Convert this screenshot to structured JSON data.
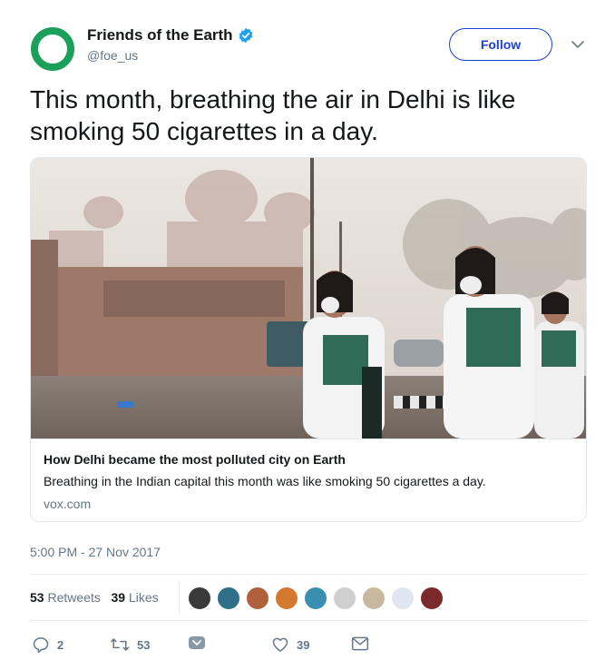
{
  "account": {
    "name": "Friends of the Earth",
    "handle": "@foe_us",
    "brand_color": "#1aa05a"
  },
  "follow_label": "Follow",
  "tweet_text": "This month, breathing the air in Delhi is like smoking 50 cigarettes in a day.",
  "card": {
    "title": "How Delhi became the most polluted city on Earth",
    "description": "Breathing in the Indian capital this month was like smoking 50 cigarettes a day.",
    "domain": "vox.com"
  },
  "timestamp": "5:00 PM - 27 Nov 2017",
  "stats": {
    "retweets_count": "53",
    "retweets_label": "Retweets",
    "likes_count": "39",
    "likes_label": "Likes"
  },
  "likers": [
    "#3a3a3a",
    "#2f6f8a",
    "#b0603a",
    "#d47a2e",
    "#3a8fb0",
    "#cfcfcf",
    "#c9b8a0",
    "#dfe6ef",
    "#7a2a2a"
  ],
  "actions": {
    "reply_count": "2",
    "retweet_count": "53",
    "like_count": "39"
  },
  "colors": {
    "accent": "#1b3fd6",
    "muted": "#657786",
    "verified": "#1da1f2"
  }
}
